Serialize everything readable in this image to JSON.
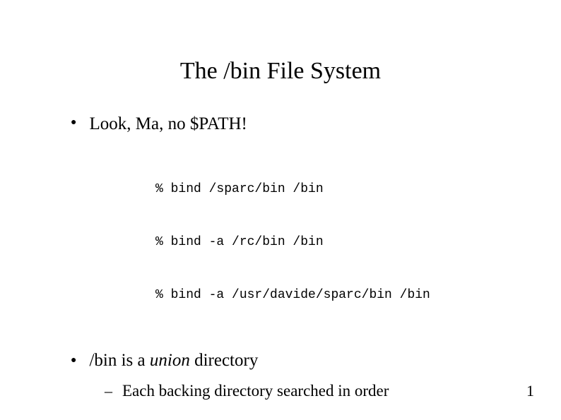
{
  "slide": {
    "title": "The /bin File System",
    "bullet1": "Look, Ma, no $PATH!",
    "code": {
      "line1": "% bind /sparc/bin /bin",
      "line2": "% bind -a /rc/bin /bin",
      "line3": "% bind -a /usr/davide/sparc/bin /bin"
    },
    "bullet2_part1": "/bin is a ",
    "bullet2_italic": "union",
    "bullet2_part2": " directory",
    "subbullet1": "Each backing directory searched in order",
    "page_number": "1"
  },
  "markers": {
    "bullet": "●",
    "dash": "–"
  }
}
